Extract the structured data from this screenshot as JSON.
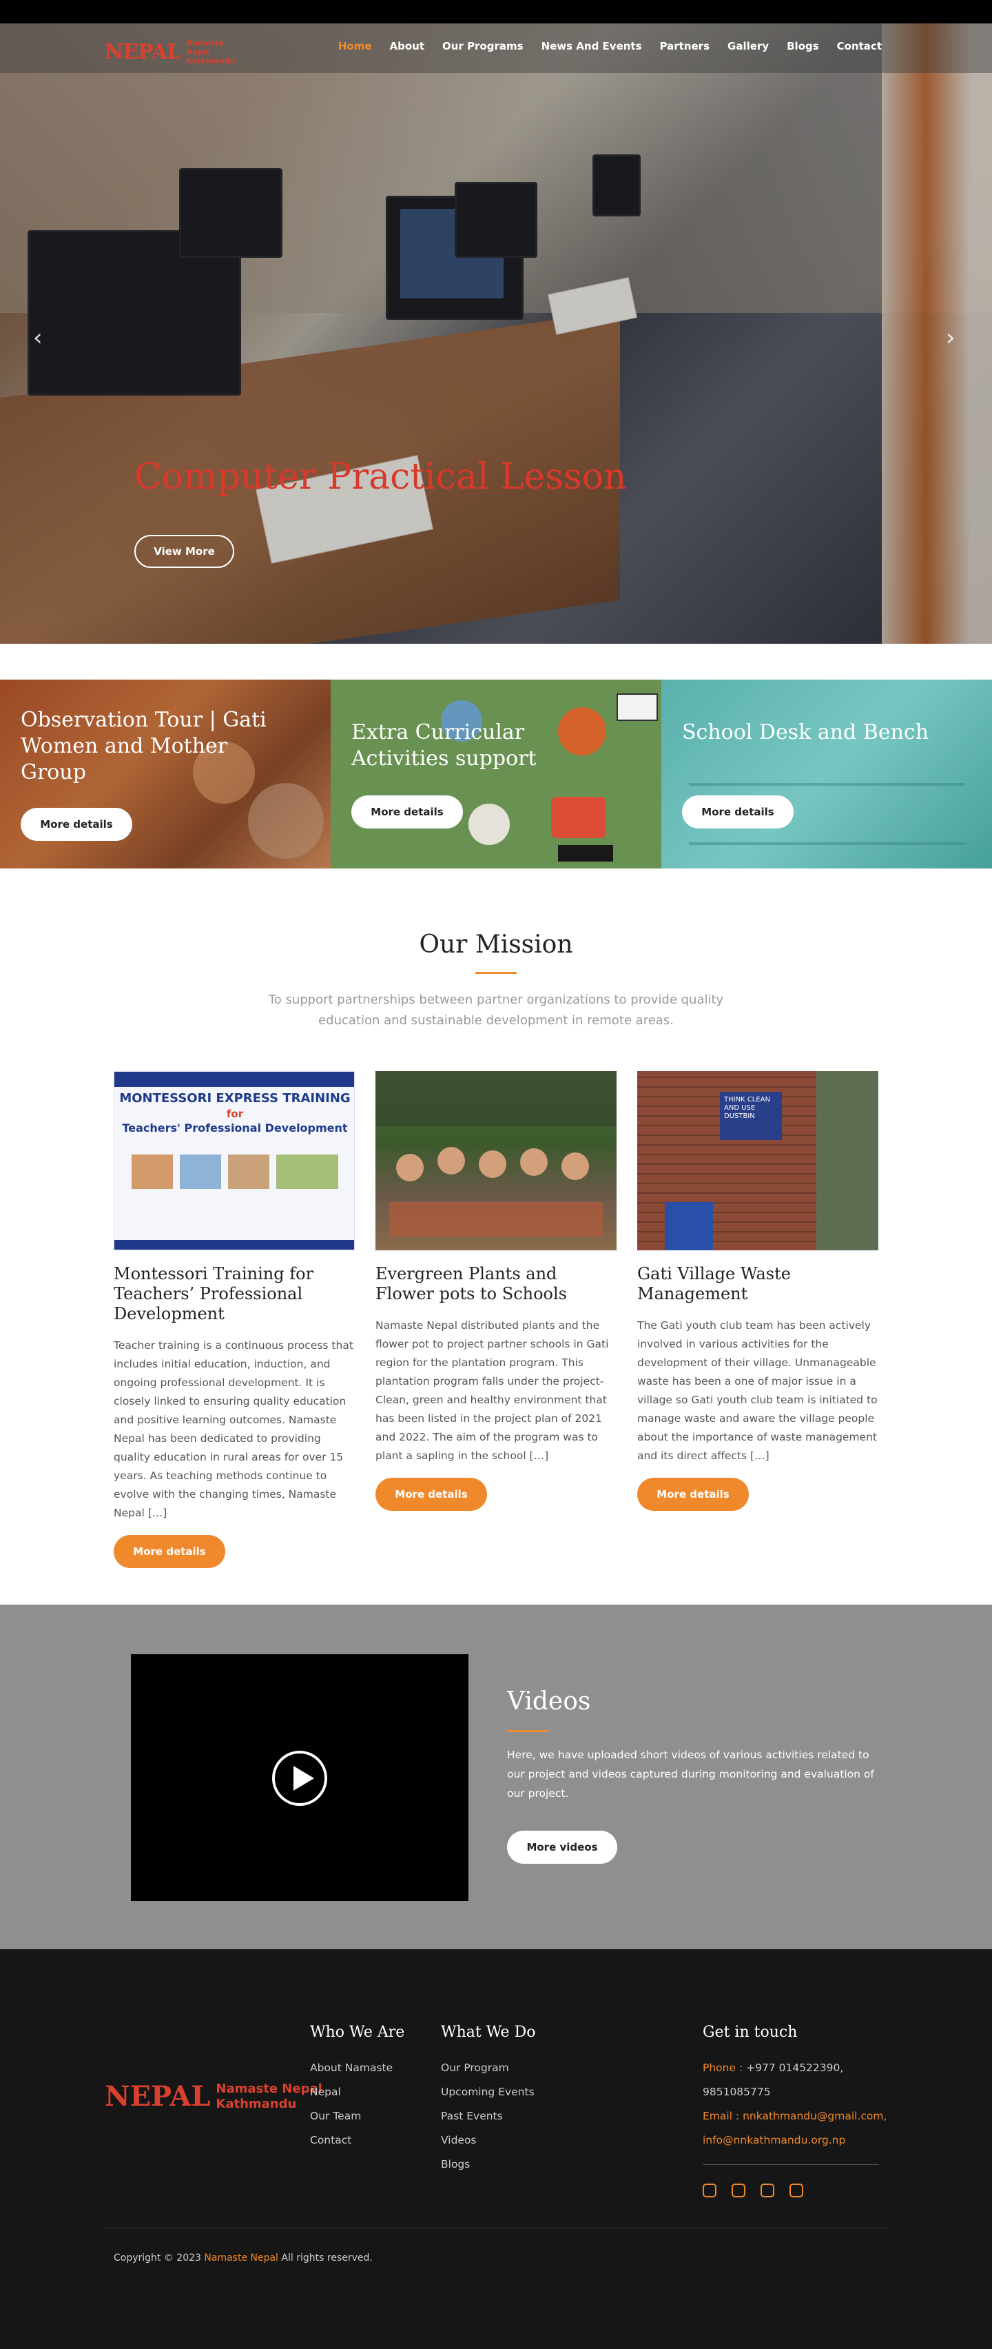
{
  "brand": {
    "logo_mark": "NEPAL",
    "logo_text_line1": "Namaste Nepal",
    "logo_text_line2": "Kathmandu"
  },
  "nav": {
    "items": [
      "Home",
      "About",
      "Our Programs",
      "News And Events",
      "Partners",
      "Gallery",
      "Blogs",
      "Contact"
    ],
    "active": "Home"
  },
  "hero": {
    "title": "Computer Practical Lesson",
    "button": "View More",
    "prev_icon": "chevron-left-icon",
    "next_icon": "chevron-right-icon"
  },
  "features": [
    {
      "title": "Observation Tour | Gati Women and Mother Group",
      "button": "More details"
    },
    {
      "title": "Extra Curricular Activities support",
      "button": "More details"
    },
    {
      "title": "School Desk and Bench",
      "button": "More details"
    }
  ],
  "mission": {
    "title": "Our Mission",
    "subtitle": "To support partnerships between partner organizations to provide quality education and sustainable development in remote areas."
  },
  "cards": [
    {
      "image_text_1": "MONTESSORI EXPRESS TRAINING",
      "image_text_2": "for",
      "image_text_3": "Teachers' Professional Development",
      "title": "Montessori Training for Teachers’ Professional Development",
      "body": "Teacher training is a continuous process that includes initial education, induction, and ongoing professional development. It is closely linked to ensuring quality education and positive learning outcomes. Namaste Nepal has been dedicated to providing quality education in rural areas for over 15 years. As teaching methods continue to evolve with the changing times, Namaste Nepal […]",
      "button": "More details"
    },
    {
      "title": "Evergreen Plants and Flower pots to Schools",
      "body": "Namaste Nepal distributed plants and the flower pot to project partner schools in Gati region for the plantation program. This plantation program falls under the project- Clean, green and healthy environment that has been listed in the project plan of 2021 and 2022. The aim of the program was to plant a sapling in the school […]",
      "button": "More details"
    },
    {
      "image_text_1": "THINK CLEAN AND USE DUSTBIN",
      "title": "Gati Village Waste Management",
      "body": "The Gati youth club team has been actively involved in various activities for the development of their village. Unmanageable waste has been a one of major issue in a village so Gati youth club team is initiated to manage waste and aware the village people about the importance of waste management and its direct affects […]",
      "button": "More details"
    }
  ],
  "videos": {
    "title": "Videos",
    "body": "Here, we have uploaded short videos of various activities related to our project and videos captured during monitoring and evaluation of our project.",
    "button": "More videos"
  },
  "footer": {
    "logo_mark": "NEPAL",
    "logo_text_line1": "Namaste Nepal",
    "logo_text_line2": "Kathmandu",
    "who_title": "Who We Are",
    "who_links": [
      "About Namaste",
      "Nepal",
      "Our Team",
      "Contact"
    ],
    "what_title": "What We Do",
    "what_links": [
      "Our Program",
      "Upcoming Events",
      "Past Events",
      "Videos",
      "Blogs"
    ],
    "contact_title": "Get in touch",
    "phone_label": "Phone :",
    "phone_1": "+977 014522390,",
    "phone_2": "9851085775",
    "email_label": "Email :",
    "email_1": "nnkathmandu@gmail.com,",
    "email_2": "info@nnkathmandu.org.np",
    "socials": [
      "instagram-icon",
      "facebook-icon",
      "youtube-icon",
      "twitter-icon"
    ],
    "copyright_prefix": "Copyright © 2023",
    "copyright_brand": "Namaste Nepal",
    "copyright_suffix": "All rights reserved."
  },
  "colors": {
    "accent": "#f0892b",
    "brand_red": "#d8392b",
    "footer_bg": "#161616",
    "videos_bg": "#8f8f8f"
  }
}
